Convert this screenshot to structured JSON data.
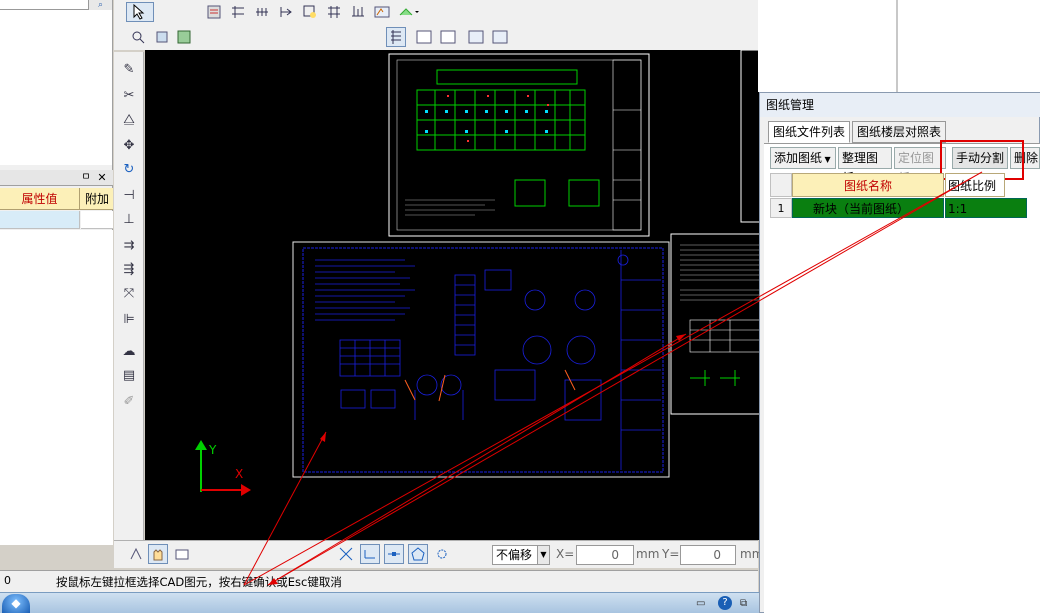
{
  "left_panel": {
    "properties_header": {
      "col_value": "属性值",
      "col_extra": "附加"
    },
    "pin_label": "ㅁ",
    "close_label": "✕"
  },
  "bottom_toolbar": {
    "offset_select": "不偏移",
    "x_label": "X=",
    "x_value": "0",
    "x_unit": "mm",
    "y_label": "Y=",
    "y_value": "0",
    "y_unit": "mm"
  },
  "status": {
    "coord": "0",
    "message": "按鼠标左键拉框选择CAD图元，按右键确认或Esc键取消"
  },
  "canvas": {
    "axis_y": "Y",
    "axis_x": "X"
  },
  "dialog": {
    "title": "图纸管理",
    "tabs": [
      {
        "label": "图纸文件列表"
      },
      {
        "label": "图纸楼层对照表"
      }
    ],
    "buttons": {
      "add": "添加图纸",
      "organize": "整理图纸",
      "locate": "定位图纸",
      "manual_split": "手动分割",
      "delete": "删除图"
    },
    "grid": {
      "headers": [
        "图纸名称",
        "图纸比例"
      ],
      "rows": [
        {
          "num": "1",
          "name": "新块（当前图纸）",
          "scale": "1:1"
        }
      ]
    }
  },
  "colors": {
    "accent_red": "#e00000",
    "row_green": "#0a7f10",
    "blueprint_blue": "#1a20e0",
    "drawing_green": "#00d000"
  }
}
